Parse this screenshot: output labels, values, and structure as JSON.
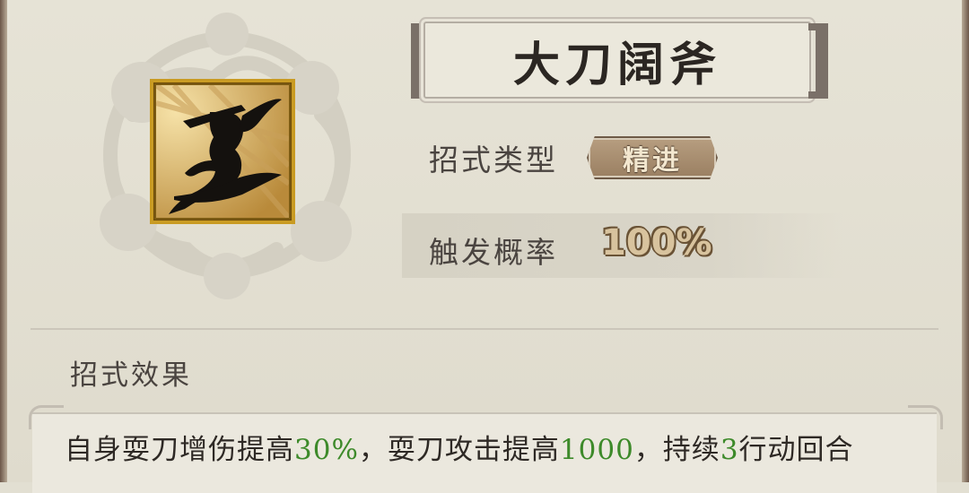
{
  "skill": {
    "title": "大刀阔斧",
    "type_label": "招式类型",
    "type_value": "精进",
    "chance_label": "触发概率",
    "chance_value": "100%",
    "icon": "swordsman-silhouette-icon"
  },
  "effect": {
    "heading": "招式效果",
    "parts": [
      "自身耍刀增伤提高",
      "30%",
      "，耍刀攻击提高",
      "1000",
      "，持续",
      "3",
      "行动回合"
    ]
  },
  "colors": {
    "highlight": "#3d8a2a",
    "icon_border": "#c99b23",
    "badge": "#a68a6c"
  }
}
